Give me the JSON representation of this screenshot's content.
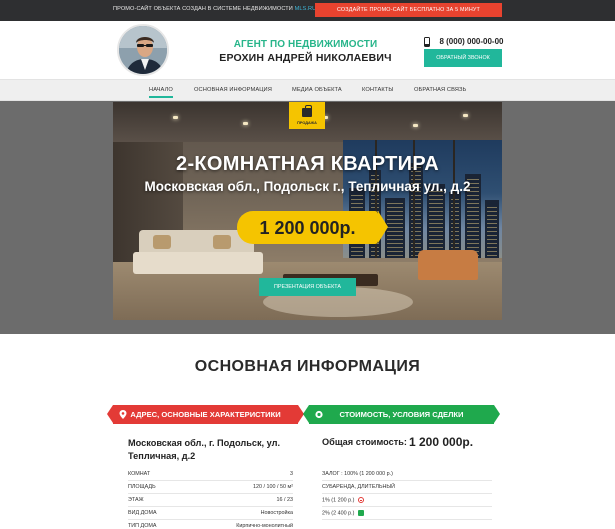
{
  "topbar": {
    "promo_text": "ПРОМО-САЙТ ОБЪЕКТА СОЗДАН В СИСТЕМЕ НЕДВИЖИМОСТИ",
    "promo_link": "MLS.RU",
    "promo_button": "СОЗДАЙТЕ ПРОМО-САЙТ БЕСПЛАТНО ЗА 5 МИНУТ"
  },
  "header": {
    "agent_subtitle": "АГЕНТ ПО НЕДВИЖИМОСТИ",
    "agent_name": "ЕРОХИН АНДРЕЙ НИКОЛАЕВИЧ",
    "phone": "8 (000) 000-00-00",
    "callback_button": "ОБРАТНЫЙ ЗВОНОК"
  },
  "nav": {
    "items": [
      "НАЧАЛО",
      "ОСНОВНАЯ ИНФОРМАЦИЯ",
      "МЕДИА ОБЪЕКТА",
      "КОНТАКТЫ",
      "ОБРАТНАЯ СВЯЗЬ"
    ],
    "active_index": 0
  },
  "hero": {
    "badge_label": "ПРОДАЖА",
    "title": "2-КОМНАТНАЯ КВАРТИРА",
    "address": "Московская обл., Подольск г., Тепличная ул., д.2",
    "price": "1 200 000р.",
    "presentation_button": "ПРЕЗЕНТАЦИЯ ОБЪЕКТА"
  },
  "main_info": {
    "title": "ОСНОВНАЯ ИНФОРМАЦИЯ",
    "left_ribbon": "АДРЕС, ОСНОВНЫЕ ХАРАКТЕРИСТИКИ",
    "right_ribbon": "СТОИМОСТЬ, УСЛОВИЯ СДЕЛКИ",
    "address_line1": "Московская обл., г. Подольск, ул.",
    "address_line2": "Тепличная, д.2",
    "total_label": "Общая стоимость:",
    "total_value": "1 200 000р.",
    "characteristics": [
      {
        "key": "КОМНАТ",
        "value": "3"
      },
      {
        "key": "ПЛОЩАДЬ",
        "value": "120 / 100 / 50 м²"
      },
      {
        "key": "ЭТАЖ",
        "value": "16 / 23"
      },
      {
        "key": "ВИД ДОМА",
        "value": "Новостройка"
      },
      {
        "key": "ТИП ДОМА",
        "value": "Кирпично-монолитный"
      }
    ],
    "conditions": [
      {
        "text": "ЗАЛОГ : 100% (1 200 000 р.)",
        "icon": ""
      },
      {
        "text": "СУБАРЕНДА, ДЛИТЕЛЬНЫЙ",
        "icon": ""
      },
      {
        "text": "1% (1 200 р.)",
        "icon": "minus-circle-icon"
      },
      {
        "text": "2% (2 400 р.)",
        "icon": "gift-icon"
      }
    ]
  },
  "colors": {
    "accent_green": "#21b79b",
    "price_yellow": "#f5c400",
    "ribbon_red": "#e33a36",
    "ribbon_green": "#1fa94d",
    "promo_red": "#e8432f"
  }
}
